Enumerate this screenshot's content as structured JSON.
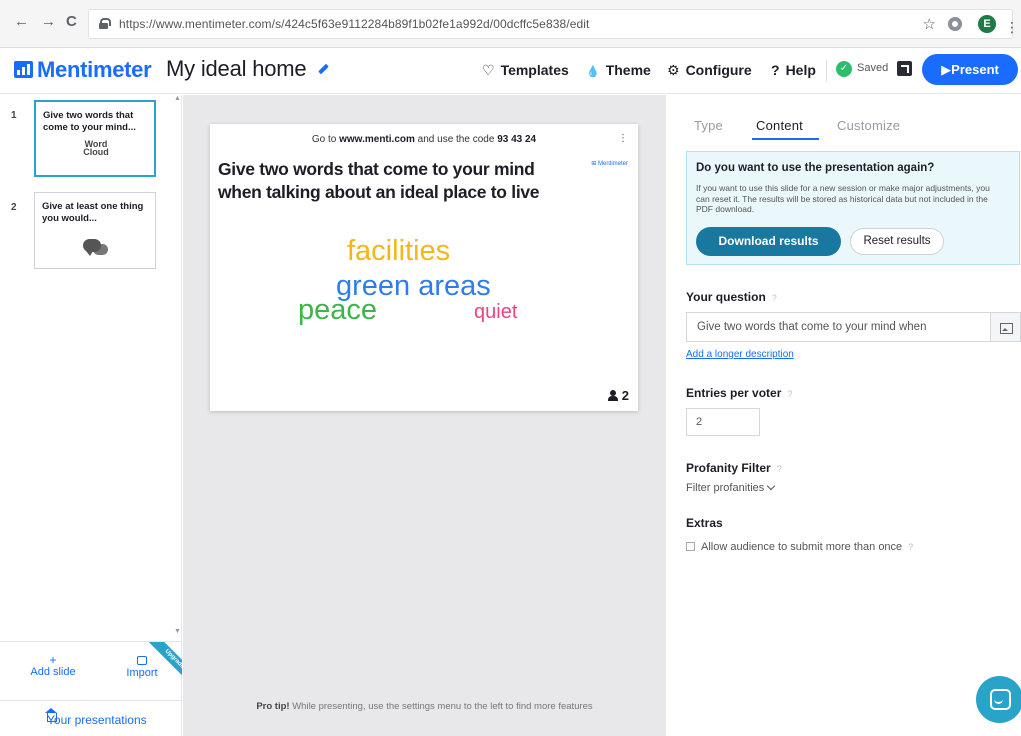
{
  "browser": {
    "url": "https://www.mentimeter.com/s/424c5f63e9112284b89f1b02fe1a992d/00dcffc5e838/edit",
    "back_glyph": "←",
    "forward_glyph": "→",
    "reload_glyph": "C",
    "star_glyph": "☆",
    "profile_initial": "E",
    "menu_glyph": "⋮"
  },
  "header": {
    "brand": "Mentimeter",
    "title": "My ideal home",
    "nav": [
      {
        "label": "Templates",
        "icon": "lightbulb-icon",
        "glyph": "♡"
      },
      {
        "label": "Theme",
        "icon": "drop-icon",
        "glyph": "💧"
      },
      {
        "label": "Configure",
        "icon": "gear-icon",
        "glyph": "⚙"
      },
      {
        "label": "Help",
        "icon": "help-icon",
        "glyph": "?"
      }
    ],
    "saved_label": "Saved",
    "saved_check": "✓",
    "present_label": "▶Present",
    "brand_color": "#196cff"
  },
  "sidebar": {
    "slides": [
      {
        "number": "1",
        "title": "Give two words that come to your mind...",
        "type": "word-cloud",
        "wc_small": "Word Cloud",
        "active": true
      },
      {
        "number": "2",
        "title": "Give at least one thing you would...",
        "type": "open-ended",
        "active": false
      }
    ],
    "scroll_up": "▲",
    "scroll_down": "▼",
    "add_slide_label": "Add slide",
    "add_slide_glyph": "+",
    "import_label": "Import",
    "upgrade_label": "Upgrade",
    "your_presentations_label": "Your presentations"
  },
  "slide": {
    "instruction_prefix": "Go to ",
    "instruction_site": "www.menti.com",
    "instruction_mid": " and use the code ",
    "instruction_code": "93 43 24",
    "menu_glyph": "⋮",
    "brand_small": "⊞ Mentimeter",
    "question": "Give two words that come to your mind when talking about an ideal place to live",
    "words": [
      {
        "text": "facilities",
        "color": "#f4b71a"
      },
      {
        "text": "green areas",
        "color": "#2f7ee8"
      },
      {
        "text": "peace",
        "color": "#3cb54a"
      },
      {
        "text": "quiet",
        "color": "#e8477d"
      }
    ],
    "voter_count": "2"
  },
  "canvas": {
    "pro_tip_bold": "Pro tip!",
    "pro_tip_text": " While presenting, use the settings menu to the left to find more features"
  },
  "panel": {
    "tabs": [
      {
        "label": "Type",
        "active": false
      },
      {
        "label": "Content",
        "active": true
      },
      {
        "label": "Customize",
        "active": false
      }
    ],
    "reuse": {
      "title": "Do you want to use the presentation again?",
      "text": "If you want to use this slide for a new session or make major adjustments, you can reset it. The results will be stored as historical data but not included in the PDF download.",
      "download_label": "Download results",
      "reset_label": "Reset results"
    },
    "your_question_label": "Your question",
    "question_value": "Give two words that come to your mind when",
    "add_description_label": "Add a longer description",
    "entries_label": "Entries per voter",
    "entries_value": "2",
    "profanity_label": "Profanity Filter",
    "profanity_select": "Filter profanities",
    "extras_label": "Extras",
    "extras_option": "Allow audience to submit more than once",
    "help_glyph": "?"
  }
}
